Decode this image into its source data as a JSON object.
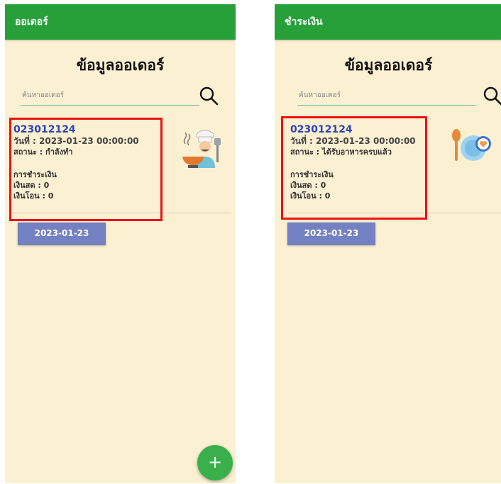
{
  "screens": [
    {
      "appbar_title": "ออเดอร์",
      "page_title": "ข้อมูลออเดอร์",
      "search_placeholder": "ค้นหาออเดอร์",
      "order": {
        "id": "023012124",
        "date_line": "วันที่ : 2023-01-23 00:00:00",
        "status_line": "สถานะ : กำลังทำ",
        "payment_heading": "การชำระเงิน",
        "cash_line": "เงินสด : 0",
        "transfer_line": "เงินโอน : 0",
        "status_icon": "chef-cooking-icon"
      },
      "date_tab": "2023-01-23",
      "fab_label": "+"
    },
    {
      "appbar_title": "ชำระเงิน",
      "page_title": "ข้อมูลออเดอร์",
      "search_placeholder": "ค้นหาออเดอร์",
      "order": {
        "id": "023012124",
        "date_line": "วันที่ : 2023-01-23 00:00:00",
        "status_line": "สถานะ : ได้รับอาหารครบแล้ว",
        "payment_heading": "การชำระเงิน",
        "cash_line": "เงินสด : 0",
        "transfer_line": "เงินโอน : 0",
        "status_icon": "plate-spoon-heart-icon"
      },
      "date_tab": "2023-01-23"
    }
  ],
  "colors": {
    "appbar": "#27a03a",
    "background": "#fcf0d2",
    "order_id": "#2a45b8",
    "date_tab": "#7381c2",
    "highlight": "#ee1111",
    "fab": "#3ab04c"
  }
}
